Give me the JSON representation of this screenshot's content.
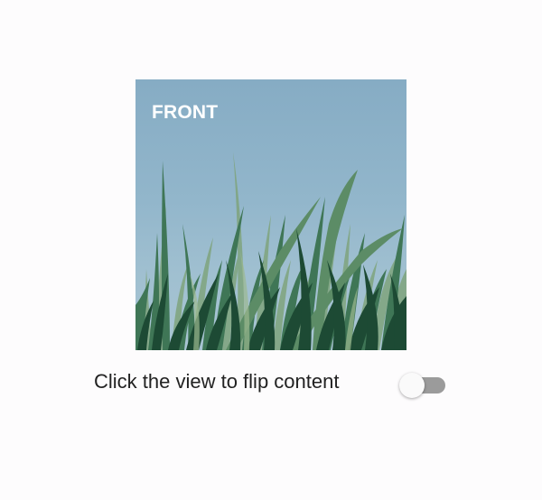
{
  "card": {
    "side_label": "FRONT",
    "image": "grass-photo",
    "sky_color": "#8fb3c8",
    "grass_colors": [
      "#1f4a35",
      "#2f6446",
      "#6f9a72"
    ]
  },
  "caption": {
    "text": "Click the view to flip content"
  },
  "switch": {
    "checked": false,
    "track_color": "#9b9b9b",
    "thumb_color": "#fafafa"
  }
}
